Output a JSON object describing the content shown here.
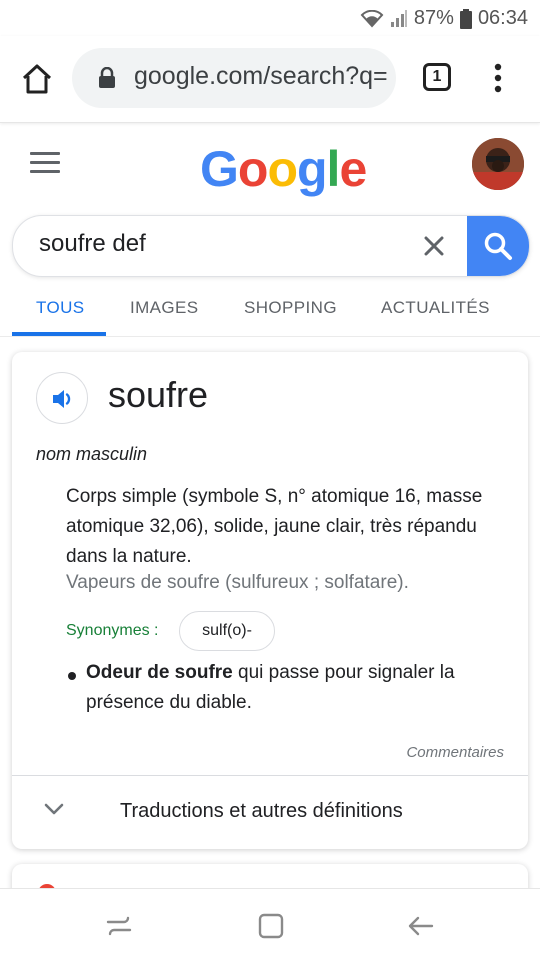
{
  "status": {
    "battery": "87%",
    "time": "06:34"
  },
  "browser": {
    "url": "google.com/search?q=",
    "tab_count": "1"
  },
  "logo": {
    "letters": [
      "G",
      "o",
      "o",
      "g",
      "l",
      "e"
    ],
    "colors": [
      "#4285F4",
      "#EA4335",
      "#FBBC05",
      "#4285F4",
      "#34A853",
      "#EA4335"
    ]
  },
  "search": {
    "query": "soufre def"
  },
  "tabs": [
    {
      "label": "TOUS"
    },
    {
      "label": "IMAGES"
    },
    {
      "label": "SHOPPING"
    },
    {
      "label": "ACTUALITÉS"
    }
  ],
  "dictionary": {
    "word": "soufre",
    "part_of_speech": "nom masculin",
    "definition": "Corps simple (symbole S, n° atomique 16, masse atomique 32,06), solide, jaune clair, très répandu dans la nature.",
    "example": "Vapeurs de soufre (sulfureux ; solfatare).",
    "synonyms_label": "Synonymes :",
    "synonym": "sulf(o)-",
    "bullet_bold": "Odeur de soufre",
    "bullet_rest": " qui passe pour signaler la présence du diable.",
    "feedback": "Commentaires",
    "expand_label": "Traductions et autres définitions"
  },
  "colors": {
    "accent": "#1a73e8",
    "search_button": "#4285f4",
    "synonym_green": "#188038"
  }
}
